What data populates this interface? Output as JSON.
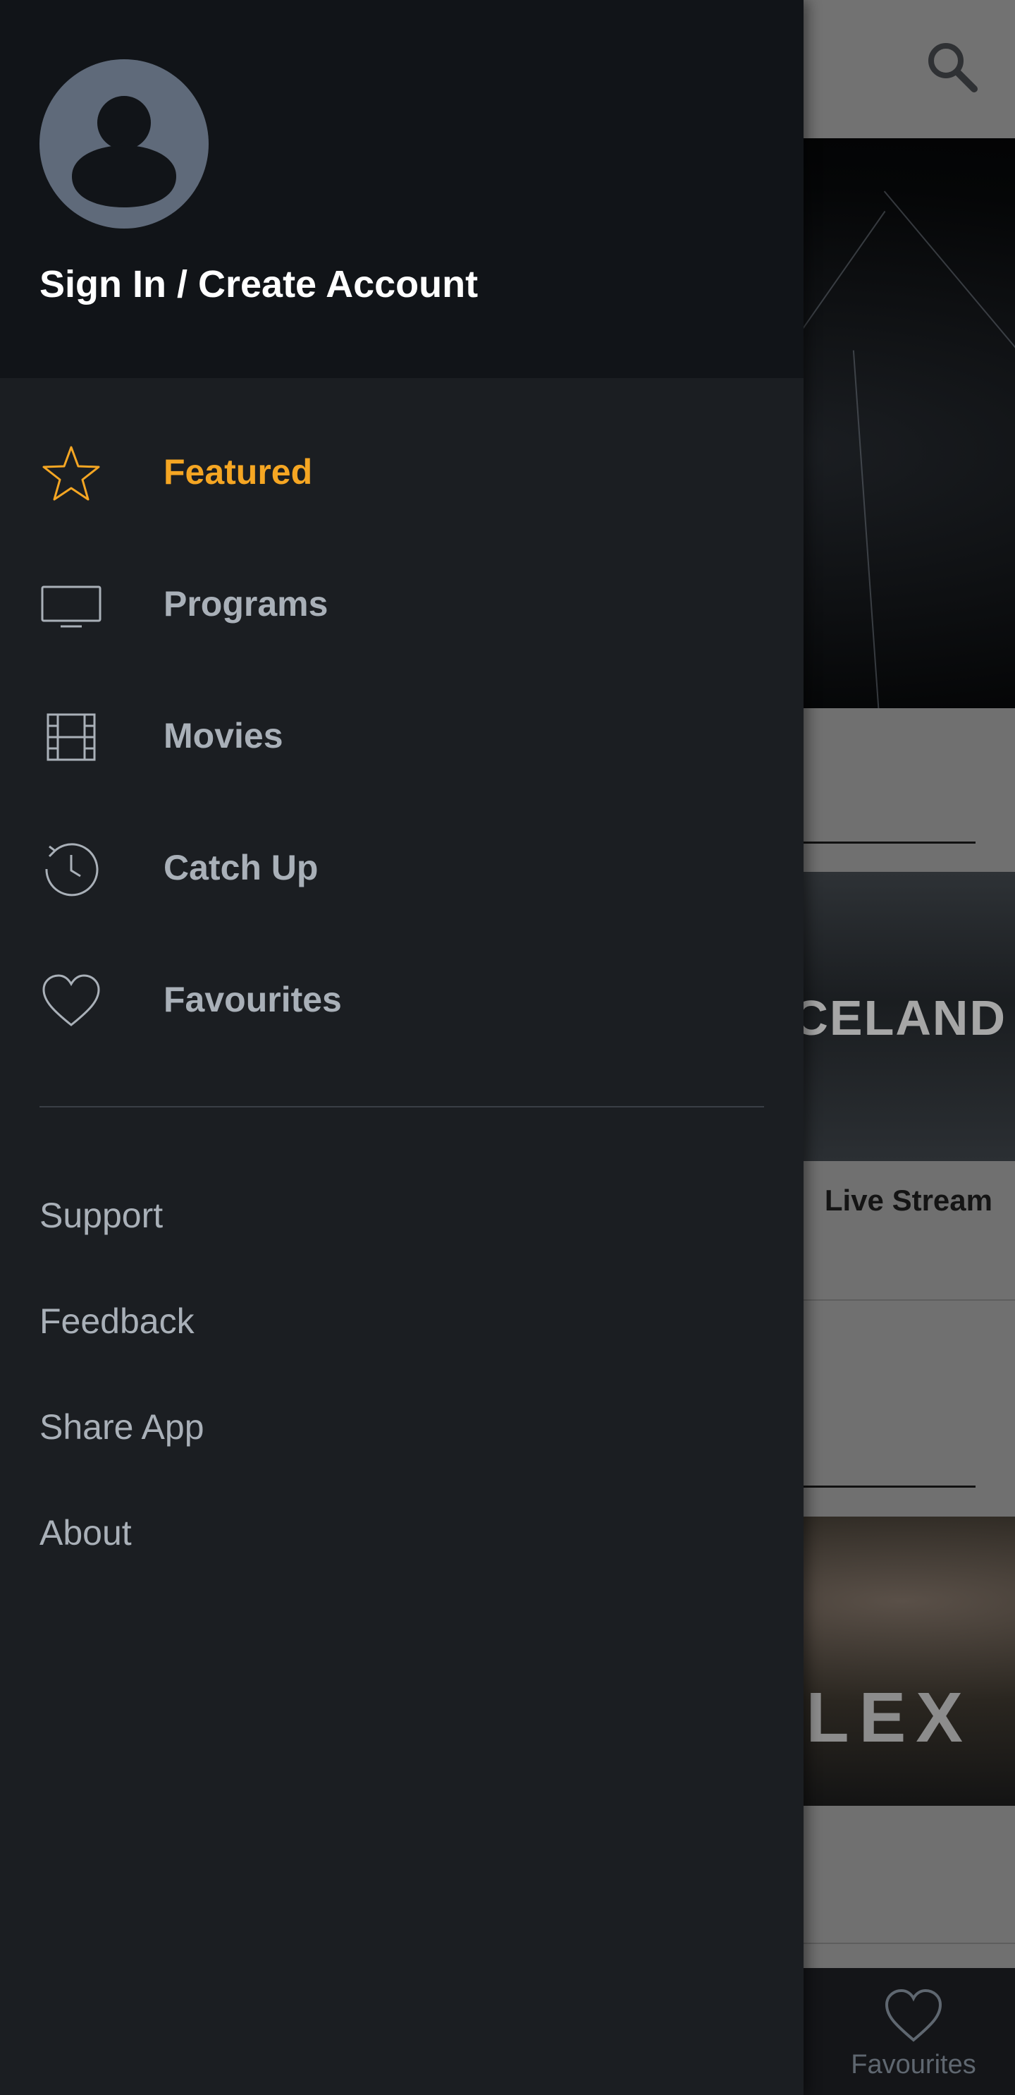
{
  "drawer": {
    "header": {
      "signin_label": "Sign In / Create Account",
      "avatar_icon": "user-avatar-icon"
    },
    "nav_items": [
      {
        "label": "Featured",
        "icon": "star-icon",
        "active": true
      },
      {
        "label": "Programs",
        "icon": "tv-icon",
        "active": false
      },
      {
        "label": "Movies",
        "icon": "film-icon",
        "active": false
      },
      {
        "label": "Catch Up",
        "icon": "history-clock-icon",
        "active": false
      },
      {
        "label": "Favourites",
        "icon": "heart-icon",
        "active": false
      }
    ],
    "secondary_links": [
      {
        "label": "Support"
      },
      {
        "label": "Feedback"
      },
      {
        "label": "Share App"
      },
      {
        "label": "About"
      }
    ]
  },
  "background": {
    "search_icon": "search-icon",
    "card1": {
      "title_text": "CELAND",
      "caption": "Live Stream"
    },
    "card2": {
      "title_text": "LEX"
    },
    "bottom_nav": {
      "favourites_label": "Favourites",
      "favourites_icon": "heart-icon"
    }
  },
  "colors": {
    "accent": "#f5a623",
    "drawer_bg": "#1b1e22",
    "drawer_header_bg": "#111418",
    "nav_text": "#a9b0b8",
    "avatar_bg": "#5f6a7a"
  }
}
